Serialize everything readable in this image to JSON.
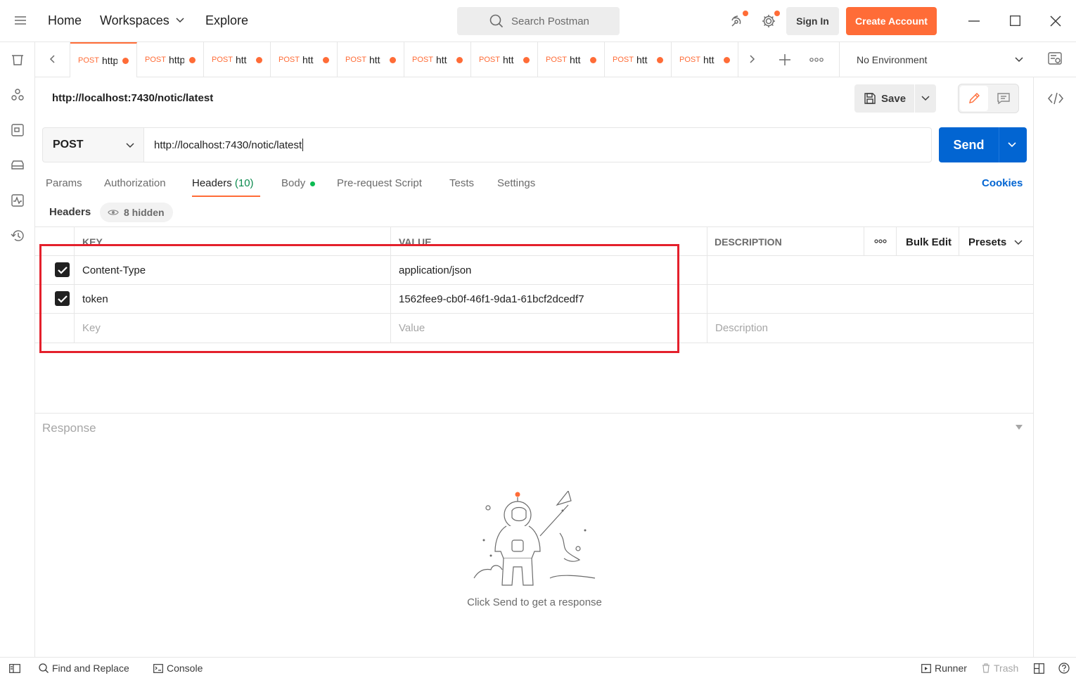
{
  "nav": {
    "home": "Home",
    "workspaces": "Workspaces",
    "explore": "Explore"
  },
  "search": {
    "placeholder": "Search Postman"
  },
  "auth": {
    "sign_in": "Sign In",
    "create_account": "Create Account"
  },
  "tabs": [
    {
      "method": "POST",
      "url": "http://localhost:7430/notic/latest",
      "short": "http"
    },
    {
      "method": "POST",
      "short": "http"
    },
    {
      "method": "POST",
      "short": "htt"
    },
    {
      "method": "POST",
      "short": "htt"
    },
    {
      "method": "POST",
      "short": "htt"
    },
    {
      "method": "POST",
      "short": "htt"
    },
    {
      "method": "POST",
      "short": "htt"
    },
    {
      "method": "POST",
      "short": "htt"
    },
    {
      "method": "POST",
      "short": "htt"
    },
    {
      "method": "POST",
      "short": "htt"
    }
  ],
  "environment": "No Environment",
  "request": {
    "title": "http://localhost:7430/notic/latest",
    "save_label": "Save",
    "method": "POST",
    "url": "http://localhost:7430/notic/latest",
    "send_label": "Send"
  },
  "request_tabs": {
    "params": "Params",
    "authorization": "Authorization",
    "headers": "Headers",
    "headers_count": "(10)",
    "body": "Body",
    "pre_request": "Pre-request Script",
    "tests": "Tests",
    "settings": "Settings",
    "cookies": "Cookies"
  },
  "headers_section": {
    "label": "Headers",
    "hidden": "8 hidden",
    "columns": {
      "key": "KEY",
      "value": "VALUE",
      "description": "DESCRIPTION"
    },
    "bulk_edit": "Bulk Edit",
    "presets": "Presets",
    "rows": [
      {
        "key": "Content-Type",
        "value": "application/json",
        "description": ""
      },
      {
        "key": "token",
        "value": "1562fee9-cb0f-46f1-9da1-61bcf2dcedf7",
        "description": ""
      }
    ],
    "placeholders": {
      "key": "Key",
      "value": "Value",
      "description": "Description"
    }
  },
  "response": {
    "label": "Response",
    "hint": "Click Send to get a response"
  },
  "status_bar": {
    "find_replace": "Find and Replace",
    "console": "Console",
    "runner": "Runner",
    "trash": "Trash"
  },
  "colors": {
    "accent": "#ff6c37",
    "primary": "#0265d2",
    "highlight_box": "#e4202c"
  }
}
